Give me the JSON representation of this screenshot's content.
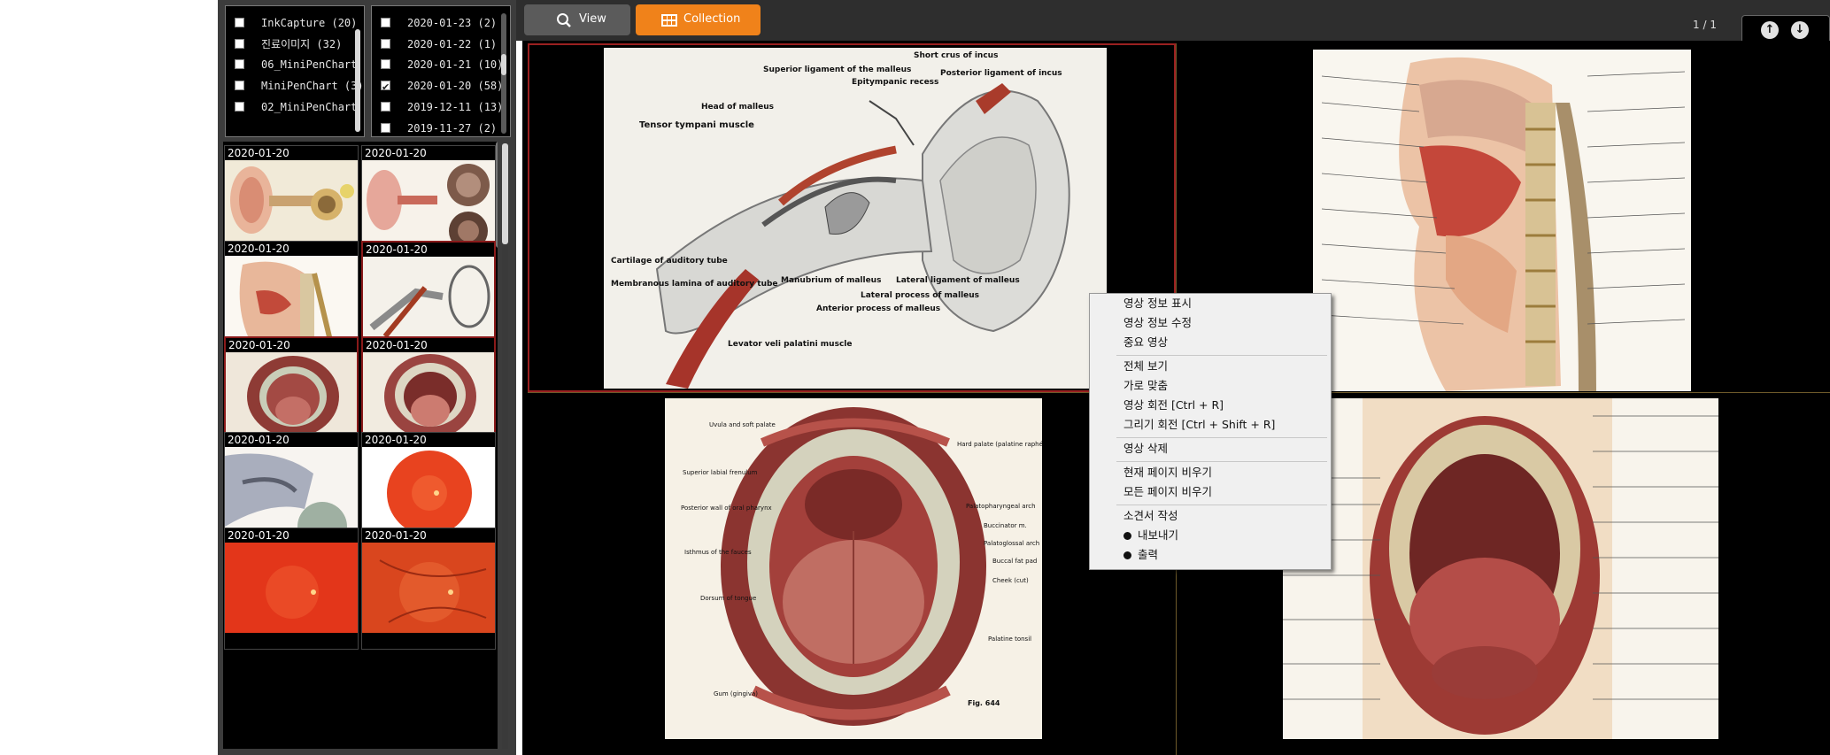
{
  "filters": {
    "categories": [
      {
        "label": "InkCapture (20)",
        "checked": false
      },
      {
        "label": "진료이미지 (32)",
        "checked": false
      },
      {
        "label": "06_MiniPenChart",
        "checked": false
      },
      {
        "label": "MiniPenChart (3)",
        "checked": false
      },
      {
        "label": "02_MiniPenChart",
        "checked": false
      }
    ],
    "dates": [
      {
        "label": "2020-01-23 (2)",
        "checked": false
      },
      {
        "label": "2020-01-22 (1)",
        "checked": false
      },
      {
        "label": "2020-01-21 (10)",
        "checked": false
      },
      {
        "label": "2020-01-20 (58)",
        "checked": true
      },
      {
        "label": "2019-12-11 (13)",
        "checked": false
      },
      {
        "label": "2019-11-27 (2)",
        "checked": false
      }
    ]
  },
  "thumbnails": [
    {
      "date": "2020-01-20",
      "selected": false,
      "icon": "ear-anatomy-color"
    },
    {
      "date": "2020-01-20",
      "selected": false,
      "icon": "ear-anatomy-drum"
    },
    {
      "date": "2020-01-20",
      "selected": false,
      "icon": "head-sagittal-section"
    },
    {
      "date": "2020-01-20",
      "selected": true,
      "icon": "ear-anatomy-sketch"
    },
    {
      "date": "2020-01-20",
      "selected": true,
      "icon": "oral-cavity"
    },
    {
      "date": "2020-01-20",
      "selected": true,
      "icon": "oral-cavity-2"
    },
    {
      "date": "2020-01-20",
      "selected": false,
      "icon": "nasal-cavity"
    },
    {
      "date": "2020-01-20",
      "selected": false,
      "icon": "retina-fundus"
    },
    {
      "date": "2020-01-20",
      "selected": false,
      "icon": "retina-fundus"
    },
    {
      "date": "2020-01-20",
      "selected": false,
      "icon": "retina-fundus-2"
    }
  ],
  "toolbar": {
    "view_label": "View",
    "collection_label": "Collection",
    "accent_color": "#f0821a",
    "page_indicator": "1 / 1"
  },
  "viewer": {
    "ear_labels": [
      "Short crus of incus",
      "Superior ligament of the malleus",
      "Posterior ligament of incus",
      "Epitympanic recess",
      "Head of malleus",
      "Tensor tympani muscle",
      "Cartilage of auditory tube",
      "Membranous lamina of auditory tube",
      "Manubrium of malleus",
      "Anterior process of malleus",
      "Lateral process of malleus",
      "Lateral ligament of malleus",
      "Levator veli palatini muscle"
    ],
    "mouth_labels": [
      "Uvula and soft palate",
      "Hard palate (palatine raphé)",
      "Superior labial frenulum",
      "Posterior wall of oral pharynx",
      "Palatopharyngeal arch",
      "Buccinator m.",
      "Palatoglossal arch",
      "Isthmus of the fauces",
      "Buccal fat pad",
      "Dorsum of tongue",
      "Cheek (cut)",
      "Palatine tonsil",
      "Gum (gingiva)",
      "Fig. 644"
    ]
  },
  "context_menu": {
    "items": [
      {
        "label": "영상 정보 표시"
      },
      {
        "label": "영상 정보 수정"
      },
      {
        "label": "중요 영상"
      },
      {
        "label": "전체 보기"
      },
      {
        "label": "가로 맞춤"
      },
      {
        "label": "영상 회전 [Ctrl + R]"
      },
      {
        "label": "그리기 회전 [Ctrl + Shift + R]"
      },
      {
        "label": "영상 삭제"
      },
      {
        "label": "현재 페이지 비우기"
      },
      {
        "label": "모든 페이지 비우기"
      },
      {
        "label": "소견서 작성"
      },
      {
        "label": "내보내기"
      },
      {
        "label": "출력"
      }
    ]
  }
}
